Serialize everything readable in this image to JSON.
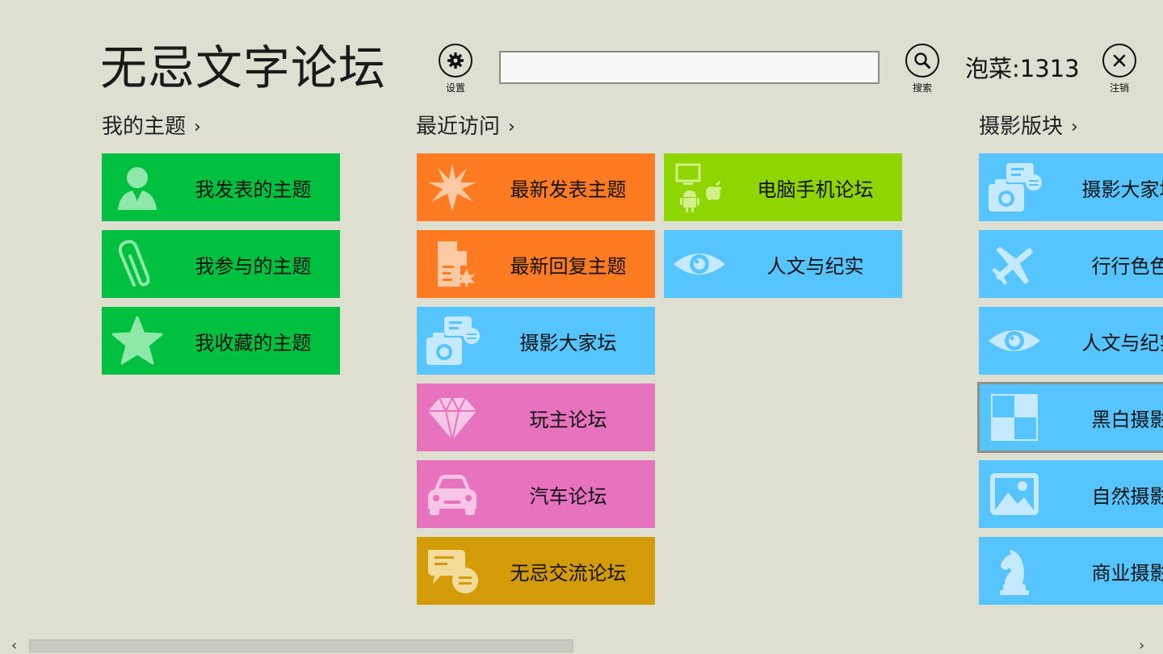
{
  "app": {
    "title": "无忌文字论坛"
  },
  "header": {
    "settings_label": "设置",
    "search_placeholder": "",
    "search_label": "搜索",
    "score_text": "泡菜:1313",
    "logout_label": "注销"
  },
  "sections": {
    "my_topics": {
      "title": "我的主题",
      "tiles": [
        {
          "label": "我发表的主题",
          "icon": "user-suit-icon"
        },
        {
          "label": "我参与的主题",
          "icon": "paperclip-icon"
        },
        {
          "label": "我收藏的主题",
          "icon": "star-icon"
        }
      ]
    },
    "recent": {
      "title": "最近访问",
      "tiles": [
        {
          "label": "最新发表主题",
          "icon": "starburst-icon"
        },
        {
          "label": "最新回复主题",
          "icon": "document-reply-icon"
        },
        {
          "label": "摄影大家坛",
          "icon": "camera-chat-icon"
        },
        {
          "label": "玩主论坛",
          "icon": "diamond-icon"
        },
        {
          "label": "汽车论坛",
          "icon": "car-icon"
        },
        {
          "label": "无忌交流论坛",
          "icon": "chat-bubbles-icon"
        },
        {
          "label": "电脑手机论坛",
          "icon": "devices-icon"
        },
        {
          "label": "人文与纪实",
          "icon": "eye-icon"
        }
      ]
    },
    "photo": {
      "title": "摄影版块",
      "tiles": [
        {
          "label": "摄影大家坛",
          "icon": "camera-chat-icon"
        },
        {
          "label": "行行色色",
          "icon": "airplane-icon"
        },
        {
          "label": "人文与纪实",
          "icon": "eye-icon"
        },
        {
          "label": "黑白摄影",
          "icon": "checkerboard-icon"
        },
        {
          "label": "自然摄影",
          "icon": "landscape-icon"
        },
        {
          "label": "商业摄影",
          "icon": "chess-knight-icon"
        }
      ]
    }
  },
  "colors": {
    "background": "#dedfd1",
    "green": "#00c040",
    "orange": "#fe7b22",
    "lightblue": "#56c5ff",
    "pink": "#e773be",
    "gold": "#d49b08",
    "lime": "#8fd500"
  },
  "scrollbar": {
    "left_arrow": "‹",
    "right_arrow": "›"
  }
}
